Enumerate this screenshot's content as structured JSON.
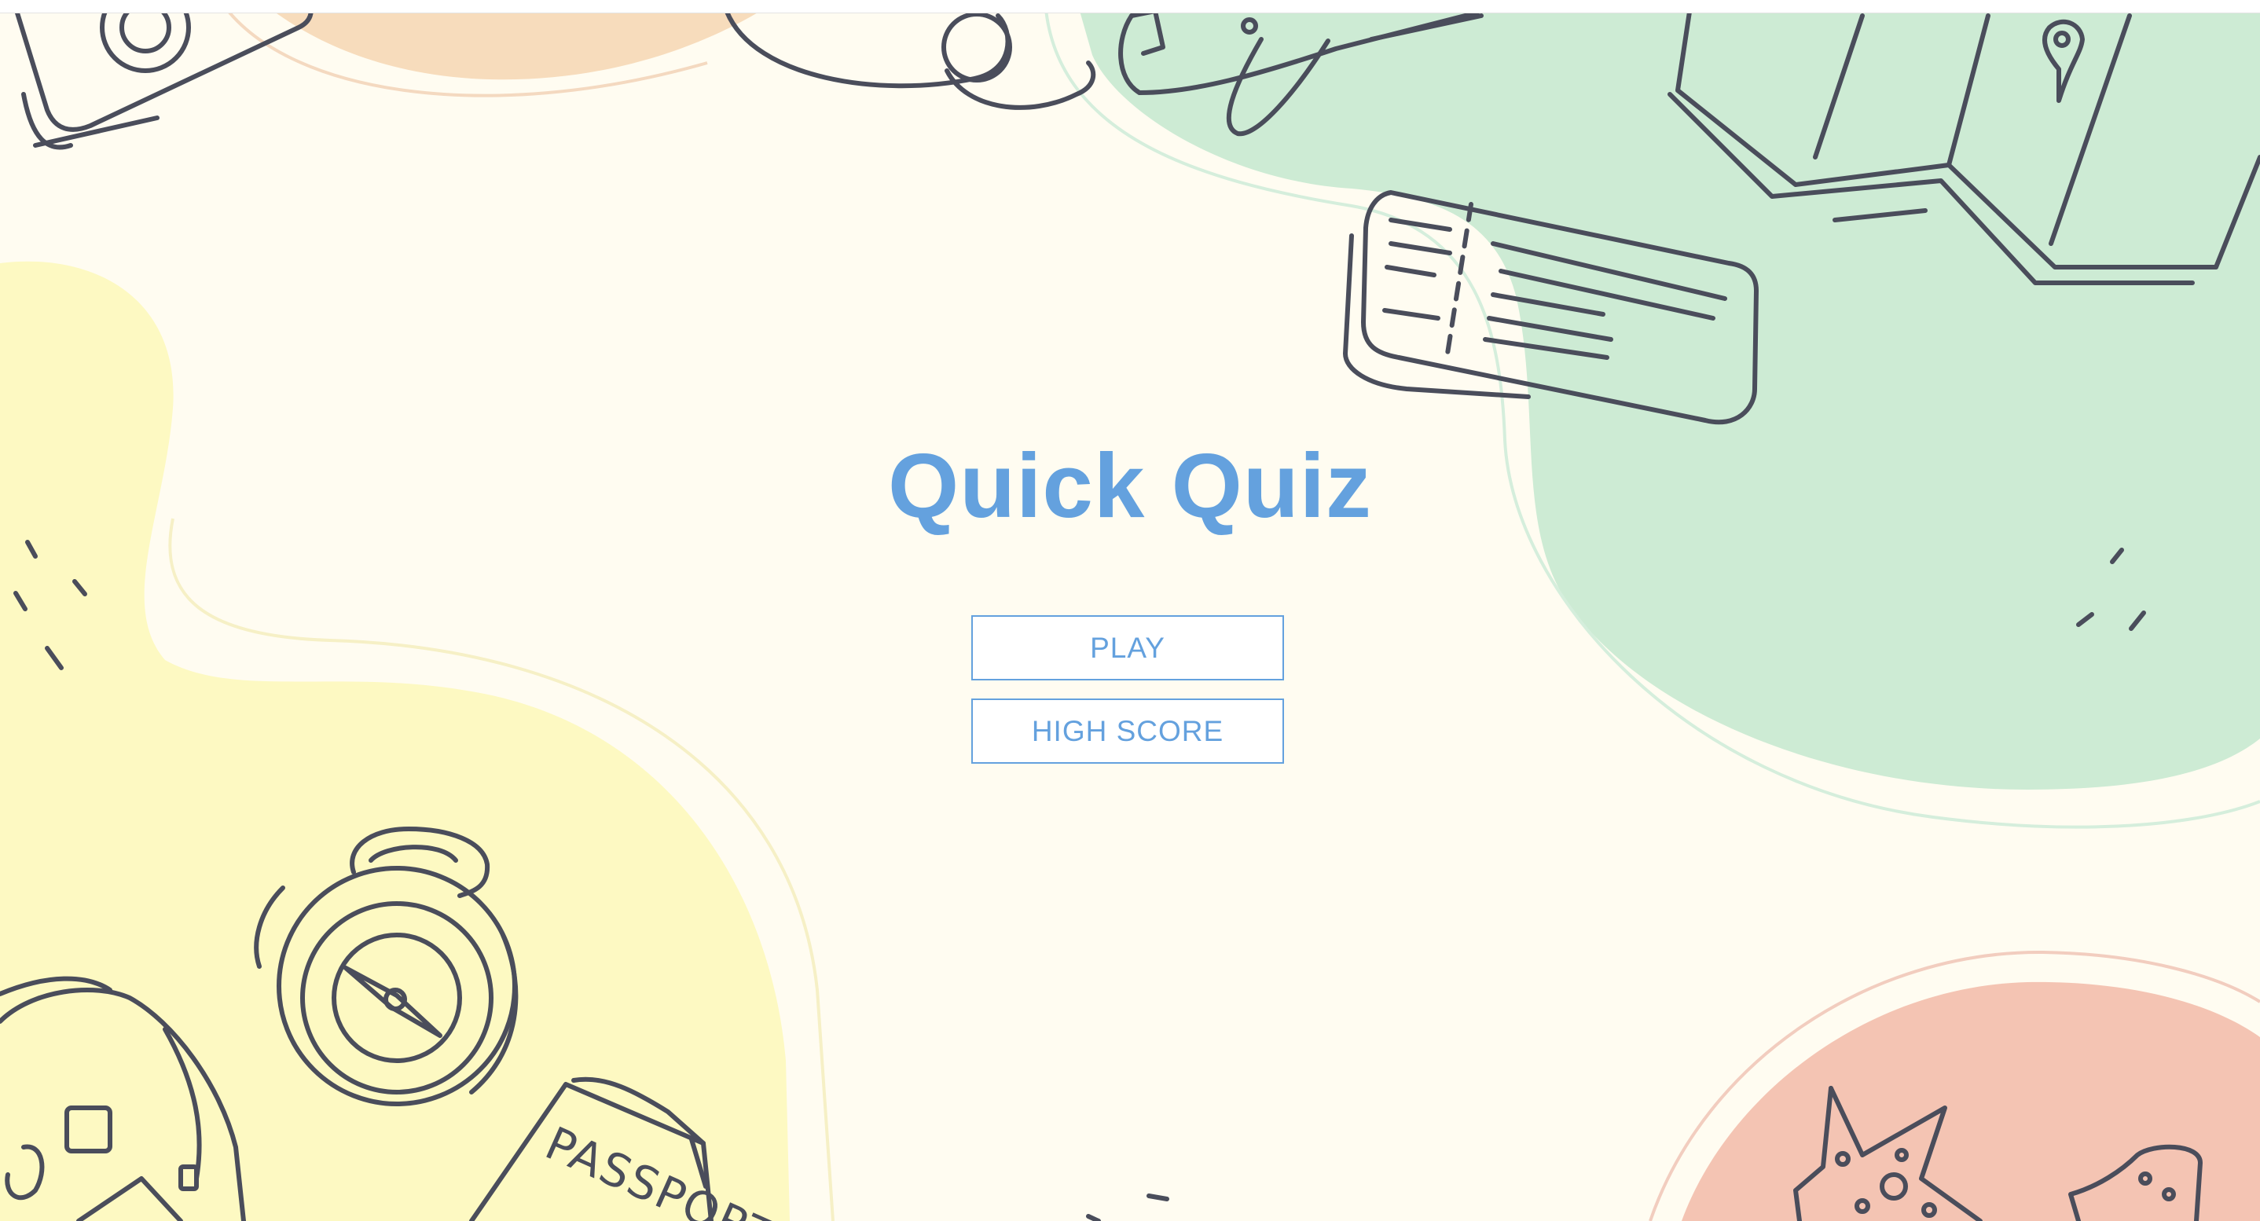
{
  "home": {
    "title": "Quick Quiz",
    "play_label": "PLAY",
    "high_score_label": "HIGH SCORE"
  },
  "background": {
    "illustration_text": "PASSPORT",
    "icons": [
      "camera-icon",
      "airplane-icon",
      "map-icon",
      "boarding-ticket-icon",
      "compass-icon",
      "backpack-icon",
      "passport-icon",
      "starfish-icon"
    ]
  },
  "colors": {
    "accent": "#64a1de",
    "page_background": "#fffcf1",
    "blob_green": "#cdebd4",
    "blob_yellow": "#fdf9c2",
    "blob_peach": "#f7dcbc",
    "blob_salmon": "#f4c4b3",
    "doodle_stroke": "#4a4d5b"
  }
}
